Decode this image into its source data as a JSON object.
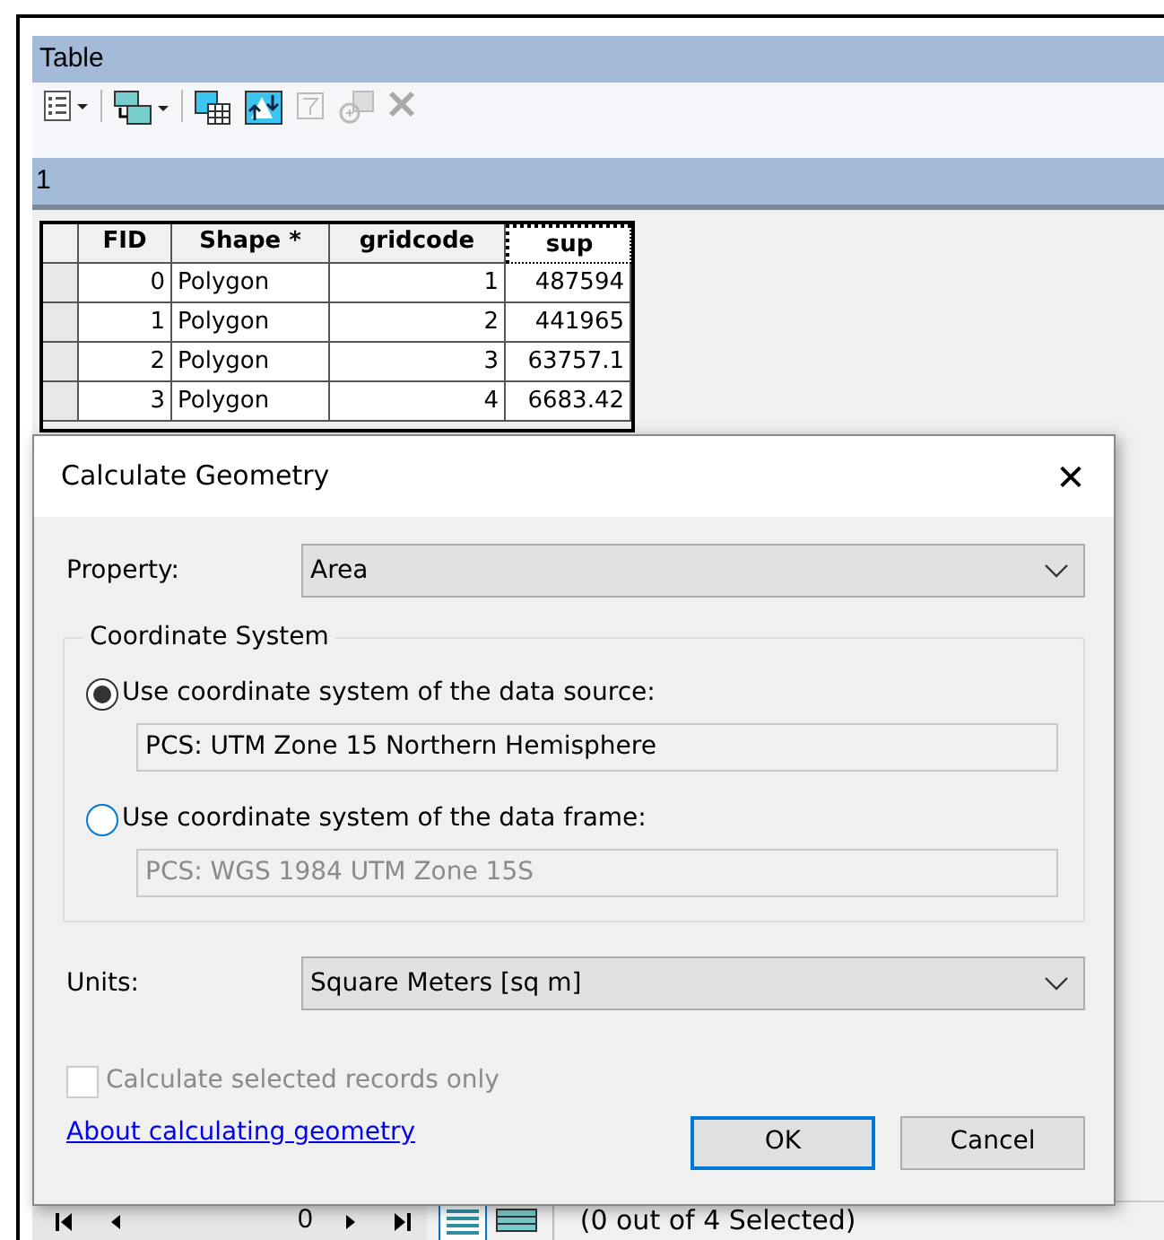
{
  "window": {
    "title": "Table"
  },
  "table_tab": {
    "label": "1"
  },
  "table": {
    "columns": [
      {
        "label": "FID",
        "selected": false
      },
      {
        "label": "Shape *",
        "selected": false
      },
      {
        "label": "gridcode",
        "selected": false
      },
      {
        "label": "sup",
        "selected": true
      }
    ],
    "rows": [
      [
        "0",
        "Polygon",
        "1",
        "487594"
      ],
      [
        "1",
        "Polygon",
        "2",
        "441965"
      ],
      [
        "2",
        "Polygon",
        "3",
        "63757.1"
      ],
      [
        "3",
        "Polygon",
        "4",
        "6683.42"
      ]
    ]
  },
  "dialog": {
    "title": "Calculate Geometry",
    "close": "✕",
    "property": {
      "label": "Property:",
      "value": "Area"
    },
    "coordinate_system": {
      "legend": "Coordinate System",
      "options": [
        {
          "label": "Use coordinate system of the data source:",
          "selected": true,
          "value": "PCS: UTM Zone 15 Northern Hemisphere"
        },
        {
          "label": "Use coordinate system of the data frame:",
          "selected": false,
          "value": "PCS: WGS 1984 UTM Zone 15S"
        }
      ]
    },
    "units": {
      "label": "Units:",
      "value": "Square Meters [sq m]"
    },
    "selected_only": {
      "label": "Calculate selected records only",
      "checked": false,
      "disabled": true
    },
    "help_link": "About calculating geometry",
    "buttons": [
      {
        "label": "OK",
        "default": true
      },
      {
        "label": "Cancel",
        "default": false
      }
    ]
  },
  "status_bar": {
    "record": "0",
    "selection": "(0 out of 4 Selected)"
  }
}
